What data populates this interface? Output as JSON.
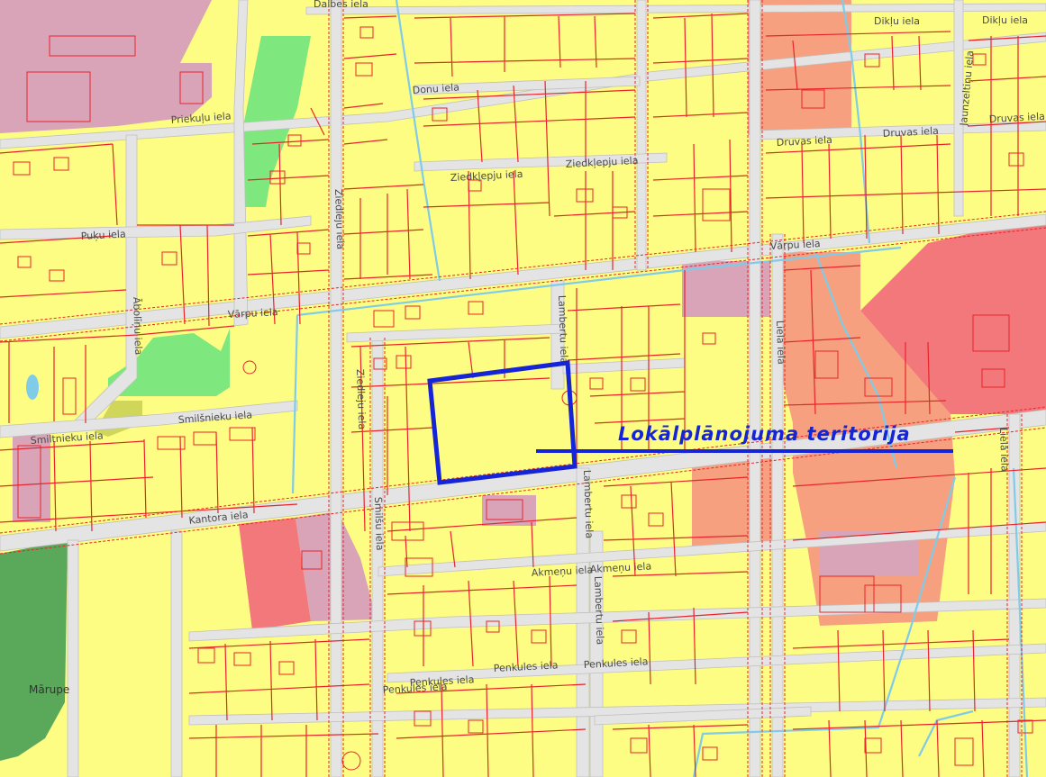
{
  "map": {
    "place_label": "Mārupe",
    "annotation": {
      "label": "Lokālplānojuma teritorija"
    },
    "colors": {
      "residential_yellow": "#fdfd83",
      "public_pink": "#d9a3b8",
      "commercial_red": "#f2787b",
      "mixed_salmon": "#f6a080",
      "green_park": "#7ee87e",
      "forest_dark_green": "#5aa85a",
      "olive": "#cfd65a",
      "road_gray": "#e4e4e4",
      "parcel_line_red": "#e8242a",
      "water_blue": "#7fcbe8",
      "annotation_blue": "#1424d6"
    },
    "streets": [
      {
        "name": "Daibes iela"
      },
      {
        "name": "Dikļu iela"
      },
      {
        "name": "Dikļu iela"
      },
      {
        "name": "Priekuļu iela"
      },
      {
        "name": "Donu iela"
      },
      {
        "name": "Jaunzeltiņu iela"
      },
      {
        "name": "Druvas iela"
      },
      {
        "name": "Druvas iela"
      },
      {
        "name": "Druvas iela"
      },
      {
        "name": "Ziedkļepju iela"
      },
      {
        "name": "Ziedkļepju iela"
      },
      {
        "name": "Puķu iela"
      },
      {
        "name": "Ziedleju iela"
      },
      {
        "name": "Vārpu iela"
      },
      {
        "name": "Vārpu iela"
      },
      {
        "name": "Ābolīņu iela"
      },
      {
        "name": "Lambertu iela"
      },
      {
        "name": "Liela iela"
      },
      {
        "name": "Smilšnieku iela"
      },
      {
        "name": "Smiltnieku iela"
      },
      {
        "name": "Ziedleju iela"
      },
      {
        "name": "Kantora iela"
      },
      {
        "name": "Smilšu iela"
      },
      {
        "name": "Lambertu iela"
      },
      {
        "name": "Lielā iela"
      },
      {
        "name": "Akmeņu iela"
      },
      {
        "name": "Akmeņu iela"
      },
      {
        "name": "Lambertu iela"
      },
      {
        "name": "Penkules iela"
      },
      {
        "name": "Penkules iela"
      },
      {
        "name": "Penkules iela"
      },
      {
        "name": "Penkules iela"
      }
    ]
  }
}
